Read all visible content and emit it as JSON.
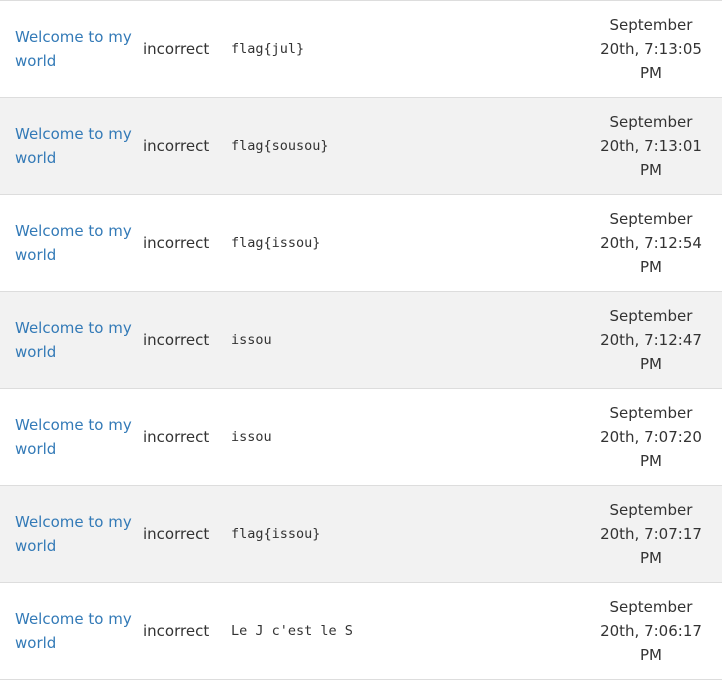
{
  "submissions": [
    {
      "challenge": "Welcome to my world",
      "result": "incorrect",
      "submission": "flag{jul}",
      "date_line1": "September",
      "date_line2": "20th, 7:13:05",
      "date_line3": "PM"
    },
    {
      "challenge": "Welcome to my world",
      "result": "incorrect",
      "submission": "flag{sousou}",
      "date_line1": "September",
      "date_line2": "20th, 7:13:01",
      "date_line3": "PM"
    },
    {
      "challenge": "Welcome to my world",
      "result": "incorrect",
      "submission": "flag{issou}",
      "date_line1": "September",
      "date_line2": "20th, 7:12:54",
      "date_line3": "PM"
    },
    {
      "challenge": "Welcome to my world",
      "result": "incorrect",
      "submission": "issou",
      "date_line1": "September",
      "date_line2": "20th, 7:12:47",
      "date_line3": "PM"
    },
    {
      "challenge": "Welcome to my world",
      "result": "incorrect",
      "submission": "issou",
      "date_line1": "September",
      "date_line2": "20th, 7:07:20",
      "date_line3": "PM"
    },
    {
      "challenge": "Welcome to my world",
      "result": "incorrect",
      "submission": "flag{issou}",
      "date_line1": "September",
      "date_line2": "20th, 7:07:17",
      "date_line3": "PM"
    },
    {
      "challenge": "Welcome to my world",
      "result": "incorrect",
      "submission": "Le J c'est le S",
      "date_line1": "September",
      "date_line2": "20th, 7:06:17",
      "date_line3": "PM"
    }
  ],
  "colors": {
    "link": "#337ab7",
    "text": "#333333",
    "stripe": "#f2f2f2",
    "border": "#dddddd"
  }
}
